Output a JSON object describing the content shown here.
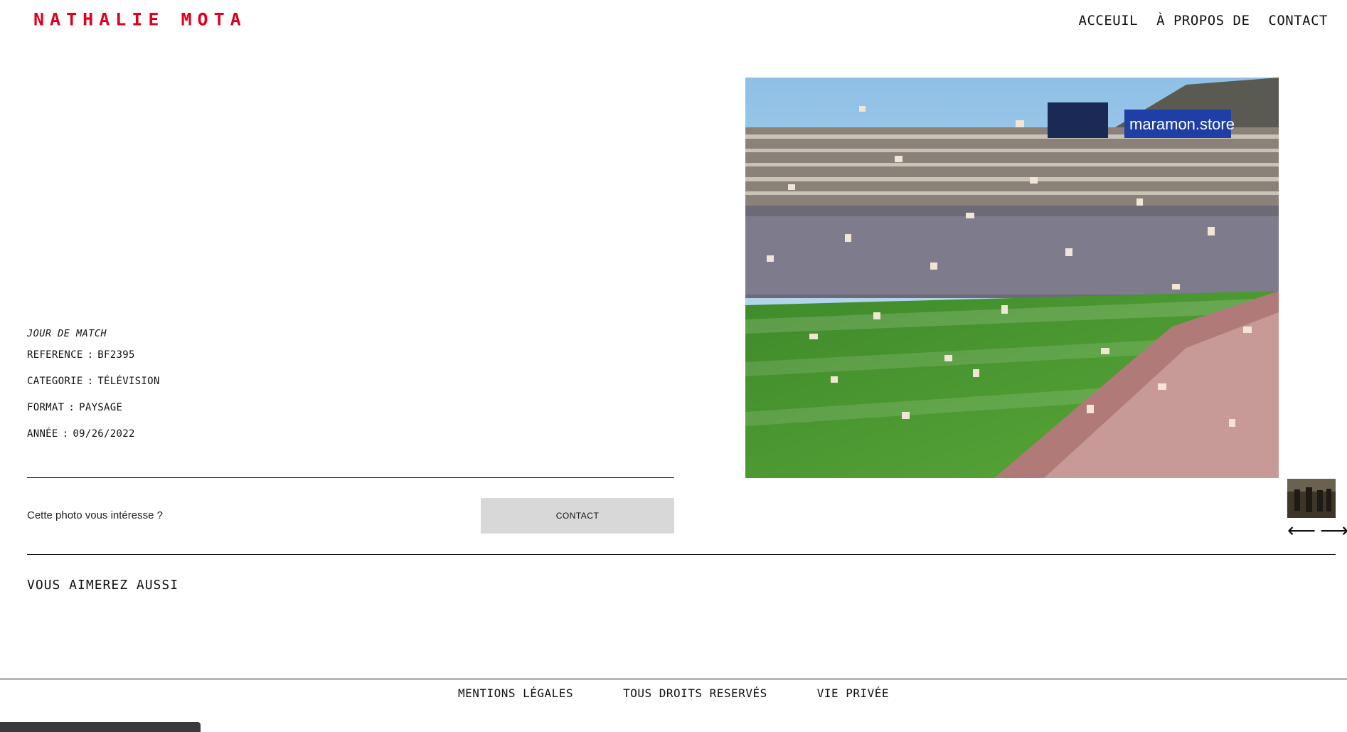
{
  "header": {
    "logo": "NATHALIE MOTA",
    "nav": [
      "ACCEUIL",
      "À PROPOS DE",
      "CONTACT"
    ]
  },
  "photo_info": {
    "title": "JOUR DE MATCH",
    "reference_label": "REFERENCE",
    "reference_value": "BF2395",
    "category_label": "CATEGORIE",
    "category_value": "TÉLÉVISION",
    "format_label": "FORMAT",
    "format_value": "PAYSAGE",
    "year_label": "ANNÉE",
    "year_value": "09/26/2022"
  },
  "interest": {
    "text": "Cette photo vous intéresse ?",
    "button": "CONTACT"
  },
  "main_photo": {
    "banner_text": "maramon.store"
  },
  "navigation": {
    "prev": "⟵",
    "next": "⟶"
  },
  "related": {
    "heading": "VOUS AIMEREZ AUSSI"
  },
  "footer": {
    "links": [
      "MENTIONS LÉGALES",
      "TOUS DROITS RESERVÉS",
      "VIE PRIVÉE"
    ]
  },
  "colors": {
    "brand": "#e0001b",
    "button_bg": "#d8d8d8"
  }
}
